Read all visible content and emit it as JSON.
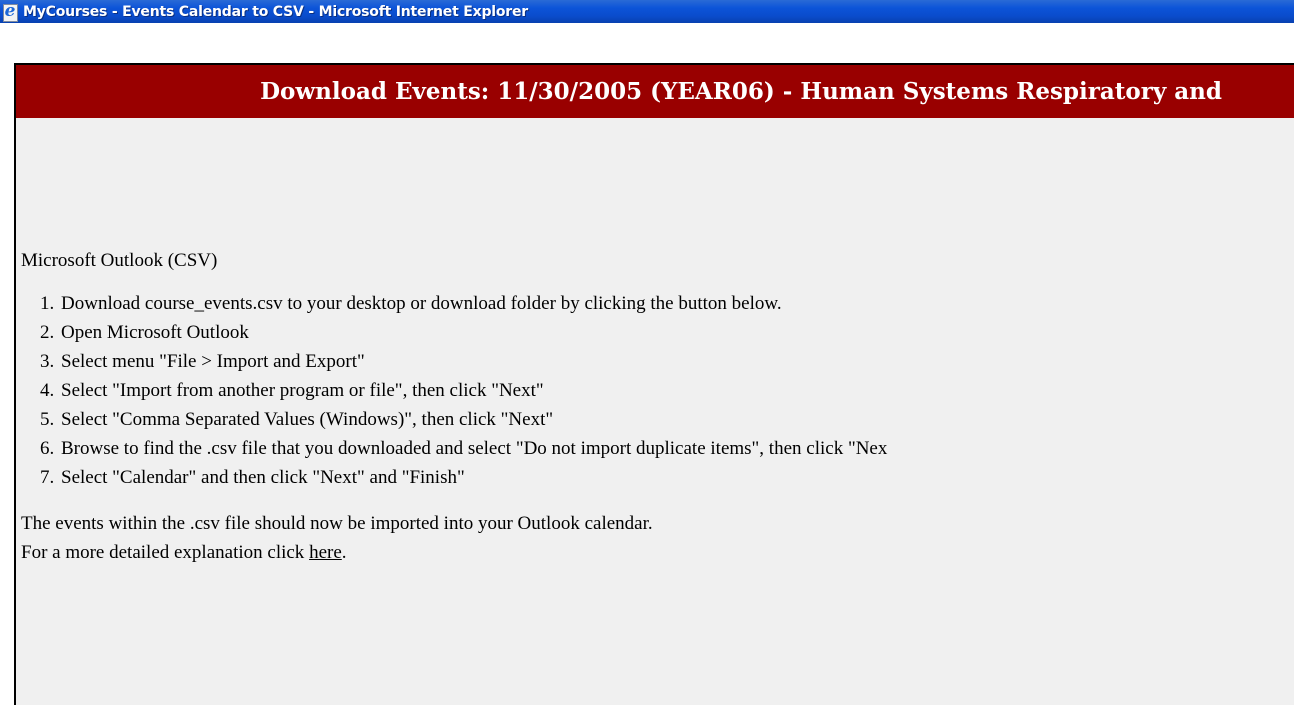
{
  "window": {
    "title": "MyCourses - Events Calendar to CSV - Microsoft Internet Explorer",
    "icon": "internet-explorer-icon"
  },
  "header": {
    "title": "Download Events: 11/30/2005 (YEAR06) - Human Systems Respiratory and"
  },
  "content": {
    "section_title": "Microsoft Outlook (CSV)",
    "steps": [
      "Download course_events.csv to your desktop or download folder by clicking the button below.",
      "Open Microsoft Outlook",
      "Select menu \"File > Import and Export\"",
      "Select \"Import from another program or file\", then click \"Next\"",
      "Select \"Comma Separated Values (Windows)\", then click \"Next\"",
      "Browse to find the .csv file that you downloaded and select \"Do not import duplicate items\", then click \"Nex",
      "Select \"Calendar\" and then click \"Next\" and \"Finish\""
    ],
    "imported_note": "The events within the .csv file should now be imported into your Outlook calendar.",
    "explanation_prefix": "For a more detailed explanation click ",
    "explanation_link": "here",
    "explanation_suffix": "."
  },
  "colors": {
    "titlebar": "#0a4ccc",
    "header_bg": "#990000",
    "panel_bg": "#f0f0f0"
  }
}
